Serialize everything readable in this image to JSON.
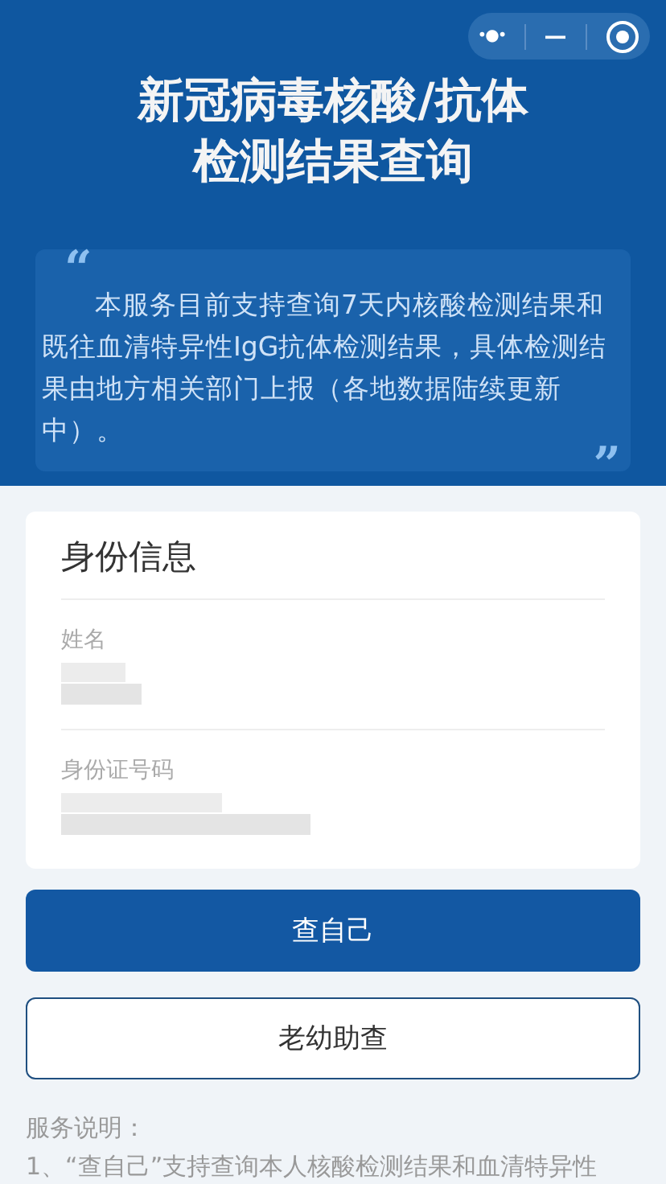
{
  "header": {
    "title_lines": [
      "新冠病毒核酸/抗体",
      "检测结果查询"
    ],
    "capsule": {
      "more": "•●•",
      "minimize": "—"
    }
  },
  "notice": {
    "open_quote": "“",
    "text": "本服务目前支持查询7天内核酸检测结果和既往血清特异性IgG抗体检测结果，具体检测结果由地方相关部门上报（各地数据陆续更新中）。",
    "close_quote": "”"
  },
  "form": {
    "heading": "身份信息",
    "fields": [
      {
        "label": "姓名",
        "redacted": true
      },
      {
        "label": "身份证号码",
        "redacted": true
      }
    ]
  },
  "buttons": [
    {
      "label": "查自己",
      "kind": "primary"
    },
    {
      "label": "老幼助查",
      "kind": "outline"
    }
  ],
  "service_notes": [
    "服务说明：",
    "1、“查自己”支持查询本人核酸检测结果和血清特异性"
  ]
}
